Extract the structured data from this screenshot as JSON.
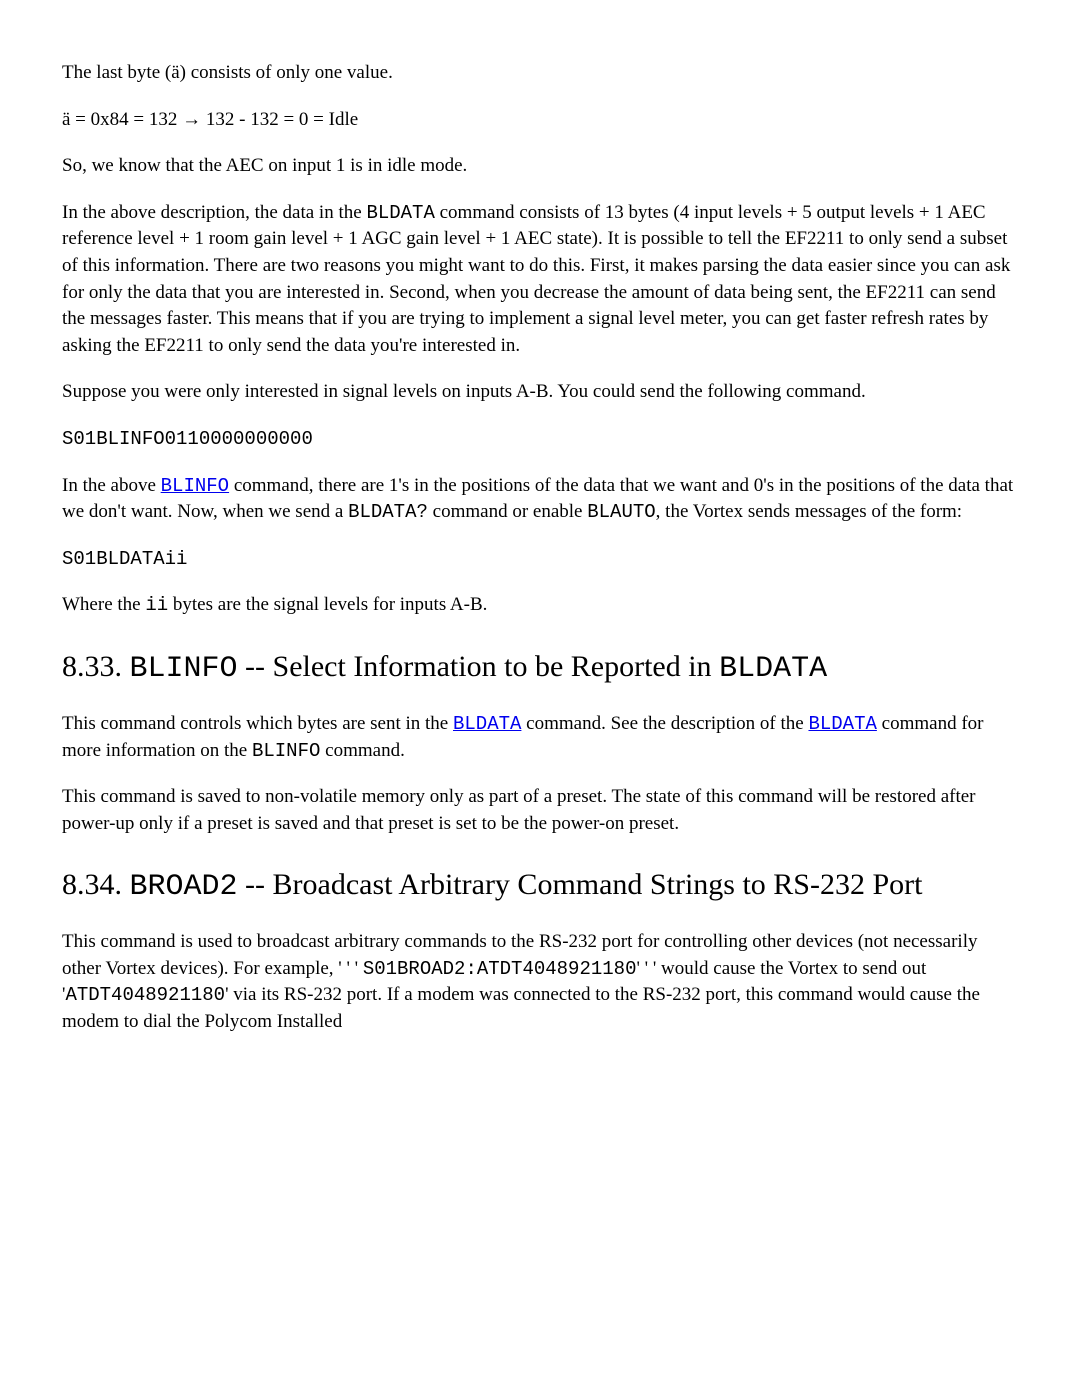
{
  "p1": "The last byte (ä) consists of only one value.",
  "p2": "ä = 0x84 = 132 → 132 - 132 = 0 = Idle",
  "p3": "So, we know that the AEC on input 1 is in idle mode.",
  "p4_a": "In the above description, the data in the ",
  "p4_b": "BLDATA",
  "p4_c": " command consists of 13 bytes (4 input levels + 5 output levels + 1 AEC reference level + 1 room gain level + 1 AGC gain level + 1 AEC state). It is possible to tell the EF2211 to only send a subset of this information. There are two reasons you might want to do this. First, it makes parsing the data easier since you can ask for only the data that you are interested in. Second, when you decrease the amount of data being sent, the EF2211 can send the messages faster. This means that if you are trying to implement a signal level meter, you can get faster refresh rates by asking the EF2211 to only send the data you're interested in.",
  "p5": "Suppose you were only interested in signal levels on inputs A-B. You could send the following command.",
  "code1": "S01BLINFO0110000000000",
  "p6_a": "In the above ",
  "p6_link": "BLINFO",
  "p6_b": " command, there are 1's in the positions of the data that we want and 0's in the positions of the data that we don't want. Now, when we send a ",
  "p6_c": "BLDATA?",
  "p6_d": " command or enable ",
  "p6_e": "BLAUTO",
  "p6_f": ", the Vortex sends messages of the form:",
  "code2": "S01BLDATAii",
  "p7_a": "Where the ",
  "p7_b": "ii",
  "p7_c": " bytes are the signal levels for inputs A-B.",
  "h833_a": "8.33. ",
  "h833_b": "BLINFO",
  "h833_c": " -- Select Information to be Reported in ",
  "h833_d": "BLDATA",
  "p8_a": "This command controls which bytes are sent in the ",
  "p8_link1": "BLDATA",
  "p8_b": " command. See the description of the ",
  "p8_link2": "BLDATA",
  "p8_c": " command for more information on the ",
  "p8_d": "BLINFO",
  "p8_e": " command.",
  "p9": "This command is saved to non-volatile memory only as part of a preset. The state of this command will be restored after power-up only if a preset is saved and that preset is set to be the power-on preset.",
  "h834_a": "8.34. ",
  "h834_b": "BROAD2",
  "h834_c": " -- Broadcast Arbitrary Command Strings to RS-232 Port",
  "p10_a": "This command is used to broadcast arbitrary commands to the RS-232 port for controlling other devices (not necessarily other Vortex devices). For example, ' ' ' ",
  "p10_b": "S01BROAD2:ATDT4048921180",
  "p10_c": "' ' ' would cause the Vortex to send out '",
  "p10_d": "ATDT4048921180",
  "p10_e": "' via its RS-232 port. If a modem was connected to the RS-232 port, this command would cause the modem to dial the Polycom Installed"
}
